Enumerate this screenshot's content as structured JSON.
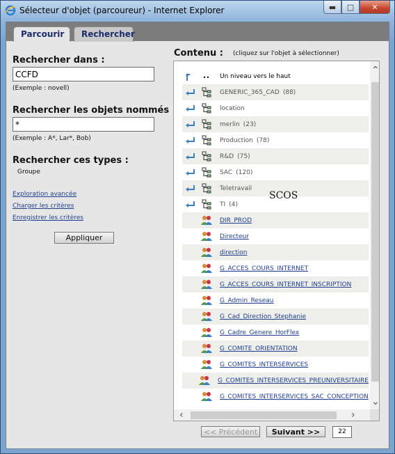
{
  "window": {
    "title": "Sélecteur d'objet (parcoureur) - Internet Explorer",
    "minimize_glyph": "▬",
    "maximize_glyph": "□",
    "close_glyph": "✕"
  },
  "tabs": [
    {
      "label": "Parcourir",
      "active": true
    },
    {
      "label": "Rechercher",
      "active": false
    }
  ],
  "search": {
    "in_label": "Rechercher dans :",
    "in_value": "CCFD",
    "in_example": "(Exemple : novell)",
    "named_label": "Rechercher les objets nommés :",
    "named_value": "*",
    "named_example": "(Exemple : A*, Lar*, Bob)",
    "types_label": "Rechercher ces types :",
    "types_value": "Groupe"
  },
  "links": {
    "advanced": "Exploration avancée",
    "load": "Charger les critères",
    "save": "Enregistrer les critères"
  },
  "apply_label": "Appliquer",
  "contenu": {
    "title": "Contenu :",
    "subtitle": "(cliquez sur l'objet à sélectionner)"
  },
  "rows": [
    {
      "type": "up",
      "label": "Un niveau vers le haut",
      "count": ""
    },
    {
      "type": "container",
      "label": "GENERIC_365_CAD",
      "count": "(88)"
    },
    {
      "type": "container",
      "label": "location",
      "count": ""
    },
    {
      "type": "container",
      "label": "merlin",
      "count": "(23)"
    },
    {
      "type": "container",
      "label": "Production",
      "count": "(78)"
    },
    {
      "type": "container",
      "label": "R&D",
      "count": "(75)"
    },
    {
      "type": "container",
      "label": "SAC",
      "count": "(120)"
    },
    {
      "type": "container",
      "label": "Teletravail",
      "count": ""
    },
    {
      "type": "container",
      "label": "TI",
      "count": "(4)"
    },
    {
      "type": "group",
      "label": "DIR_PROD",
      "count": ""
    },
    {
      "type": "group",
      "label": "Directeur",
      "count": ""
    },
    {
      "type": "group",
      "label": "direction",
      "count": ""
    },
    {
      "type": "group",
      "label": "G_ACCES_COURS_INTERNET",
      "count": ""
    },
    {
      "type": "group",
      "label": "G_ACCES_COURS_INTERNET_INSCRIPTION",
      "count": ""
    },
    {
      "type": "group",
      "label": "G_Admin_Reseau",
      "count": ""
    },
    {
      "type": "group",
      "label": "G_Cad_Direction_Stephanie",
      "count": ""
    },
    {
      "type": "group",
      "label": "G_Cadre_Genere_HorFlex",
      "count": ""
    },
    {
      "type": "group",
      "label": "G_COMITE_ORIENTATION",
      "count": ""
    },
    {
      "type": "group",
      "label": "G_COMITES_INTERSERVICES",
      "count": ""
    },
    {
      "type": "group",
      "label": "G_COMITES_INTERSERVICES_PREUNIVERSITAIRE",
      "count": ""
    },
    {
      "type": "group",
      "label": "G_COMITES_INTERSERVICES_SAC_CONCEPTION",
      "count": ""
    }
  ],
  "annotation": "SCOS",
  "pager": {
    "prev_label": "<< Précédent",
    "next_label": "Suivant >>",
    "page_size": "22"
  },
  "icons": {
    "up": "up-level-icon",
    "container_arrow": "enter-container-icon",
    "container": "org-unit-icon",
    "group": "group-icon"
  }
}
